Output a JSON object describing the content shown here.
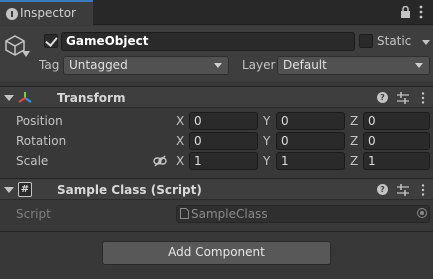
{
  "tab": {
    "title": "Inspector"
  },
  "gameobject": {
    "active": true,
    "name": "GameObject",
    "static_label": "Static",
    "tag_label": "Tag",
    "tag_value": "Untagged",
    "layer_label": "Layer",
    "layer_value": "Default"
  },
  "transform": {
    "title": "Transform",
    "rows": [
      {
        "label": "Position",
        "x": "0",
        "y": "0",
        "z": "0"
      },
      {
        "label": "Rotation",
        "x": "0",
        "y": "0",
        "z": "0"
      },
      {
        "label": "Scale",
        "x": "1",
        "y": "1",
        "z": "1"
      }
    ],
    "axes": {
      "x": "X",
      "y": "Y",
      "z": "Z"
    },
    "help_glyph": "?"
  },
  "script_component": {
    "title": "Sample Class (Script)",
    "field_label": "Script",
    "script_value": "SampleClass",
    "enabled": true,
    "icon_glyph": "#",
    "help_glyph": "?"
  },
  "add_component_label": "Add Component",
  "colors": {
    "accent": "#3a79bb",
    "panel": "#383838",
    "header": "#3e3e3e",
    "field": "#2a2a2a",
    "transform_x_axis": "#e04a3a",
    "transform_y_axis": "#7ccc3c",
    "transform_z_axis": "#3a8ee0"
  }
}
